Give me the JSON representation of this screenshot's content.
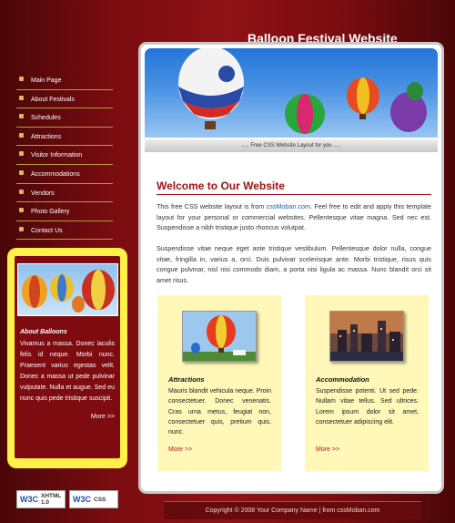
{
  "header": {
    "site_title": "Balloon Festival Website"
  },
  "nav": {
    "items": [
      {
        "label": "Main Page"
      },
      {
        "label": "About Festivals"
      },
      {
        "label": "Schedules"
      },
      {
        "label": "Attractions"
      },
      {
        "label": "Visitor Information"
      },
      {
        "label": "Accommodations"
      },
      {
        "label": "Vendors"
      },
      {
        "label": "Photo Gallery"
      },
      {
        "label": "Contact Us"
      }
    ]
  },
  "sidebar": {
    "title": "About Balloons",
    "text": "Vivamus a massa. Donec iaculis felis id neque. Morbi nunc. Praesent varius egestas velit. Donec a massa ut pede pulvinar vulputate. Nulla et augue. Sed eu nunc quis pede tristique suscipit.",
    "more": "More >>"
  },
  "banner": {
    "caption": "..... Free CSS Website Layout for you ....."
  },
  "main": {
    "heading": "Welcome to Our Website",
    "p1_before": "This free CSS website layout is from ",
    "p1_link": "cssMoban.com",
    "p1_after": ". Feel free to edit and apply this template layout for your personal or commercial websites. Pellentesque vitae magna. Sed nec est. Suspendisse a nibh tristique justo rhoncus volutpat.",
    "p2": "Suspendisse vitae neque eget ante tristique vestibulum. Pellentesque dolor nulla, congue vitae, fringilla in, varius a, orci. Duis pulvinar scelerisque ante. Morbi tristique, risus quis congue pulvinar, nisl nisi commodo diam, a porta nisi ligula ac massa. Nunc blandit orci sit amet risus."
  },
  "features": [
    {
      "title": "Attractions",
      "text": "Mauris blandit vehicula neque. Proin consectetuer. Donec venenatis. Cras urna metus, feugiat non, consectetuer quis, pretium quis, nunc.",
      "more": "More >>"
    },
    {
      "title": "Accommodation",
      "text": "Suspendisse potenti. Ut sed pede. Nullam vitae tellus. Sed ultrices. Lorem ipsum dolor sit amet, consectetuer adipiscing elit.",
      "more": "More >>"
    }
  ],
  "badges": [
    {
      "logo": "W3C",
      "label_line1": "XHTML",
      "label_line2": "1.0"
    },
    {
      "logo": "W3C",
      "label_line1": "CSS",
      "label_line2": ""
    }
  ],
  "footer": {
    "text": "Copyright © 2008 Your Company Name | from cssMoban.com"
  },
  "colors": {
    "accent": "#a11217",
    "sidebar_box": "#fff04a",
    "feature_bg": "#fff8b8",
    "link": "#1a5bbf"
  }
}
